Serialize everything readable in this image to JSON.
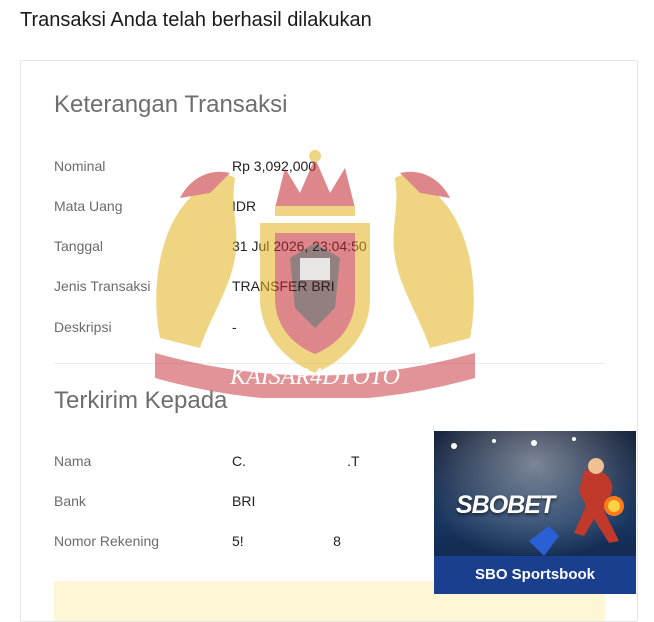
{
  "page_title": "Transaksi Anda telah berhasil dilakukan",
  "section1": {
    "title": "Keterangan Transaksi",
    "rows": [
      {
        "label": "Nominal",
        "value": "Rp 3,092,000"
      },
      {
        "label": "Mata Uang",
        "value": "IDR"
      },
      {
        "label": "Tanggal",
        "value": "31 Jul 2026, 23:04:50"
      },
      {
        "label": "Jenis Transaksi",
        "value": "TRANSFER BRI"
      },
      {
        "label": "Deskripsi",
        "value": "-"
      }
    ]
  },
  "section2": {
    "title": "Terkirim Kepada",
    "rows": [
      {
        "label": "Nama",
        "value": "C.                          .T"
      },
      {
        "label": "Bank",
        "value": "BRI"
      },
      {
        "label": "Nomor Rekening",
        "value": "5!                       8"
      }
    ]
  },
  "watermark_text": "KAISAR4DTOTO",
  "ad": {
    "brand": "SBOBET",
    "tagline": "SBO Sportsbook"
  },
  "colors": {
    "accent_yellow": "#fff6d6",
    "watermark_red": "#c4262e",
    "watermark_gold": "#e2b21d",
    "ad_blue": "#1b3f8f"
  }
}
